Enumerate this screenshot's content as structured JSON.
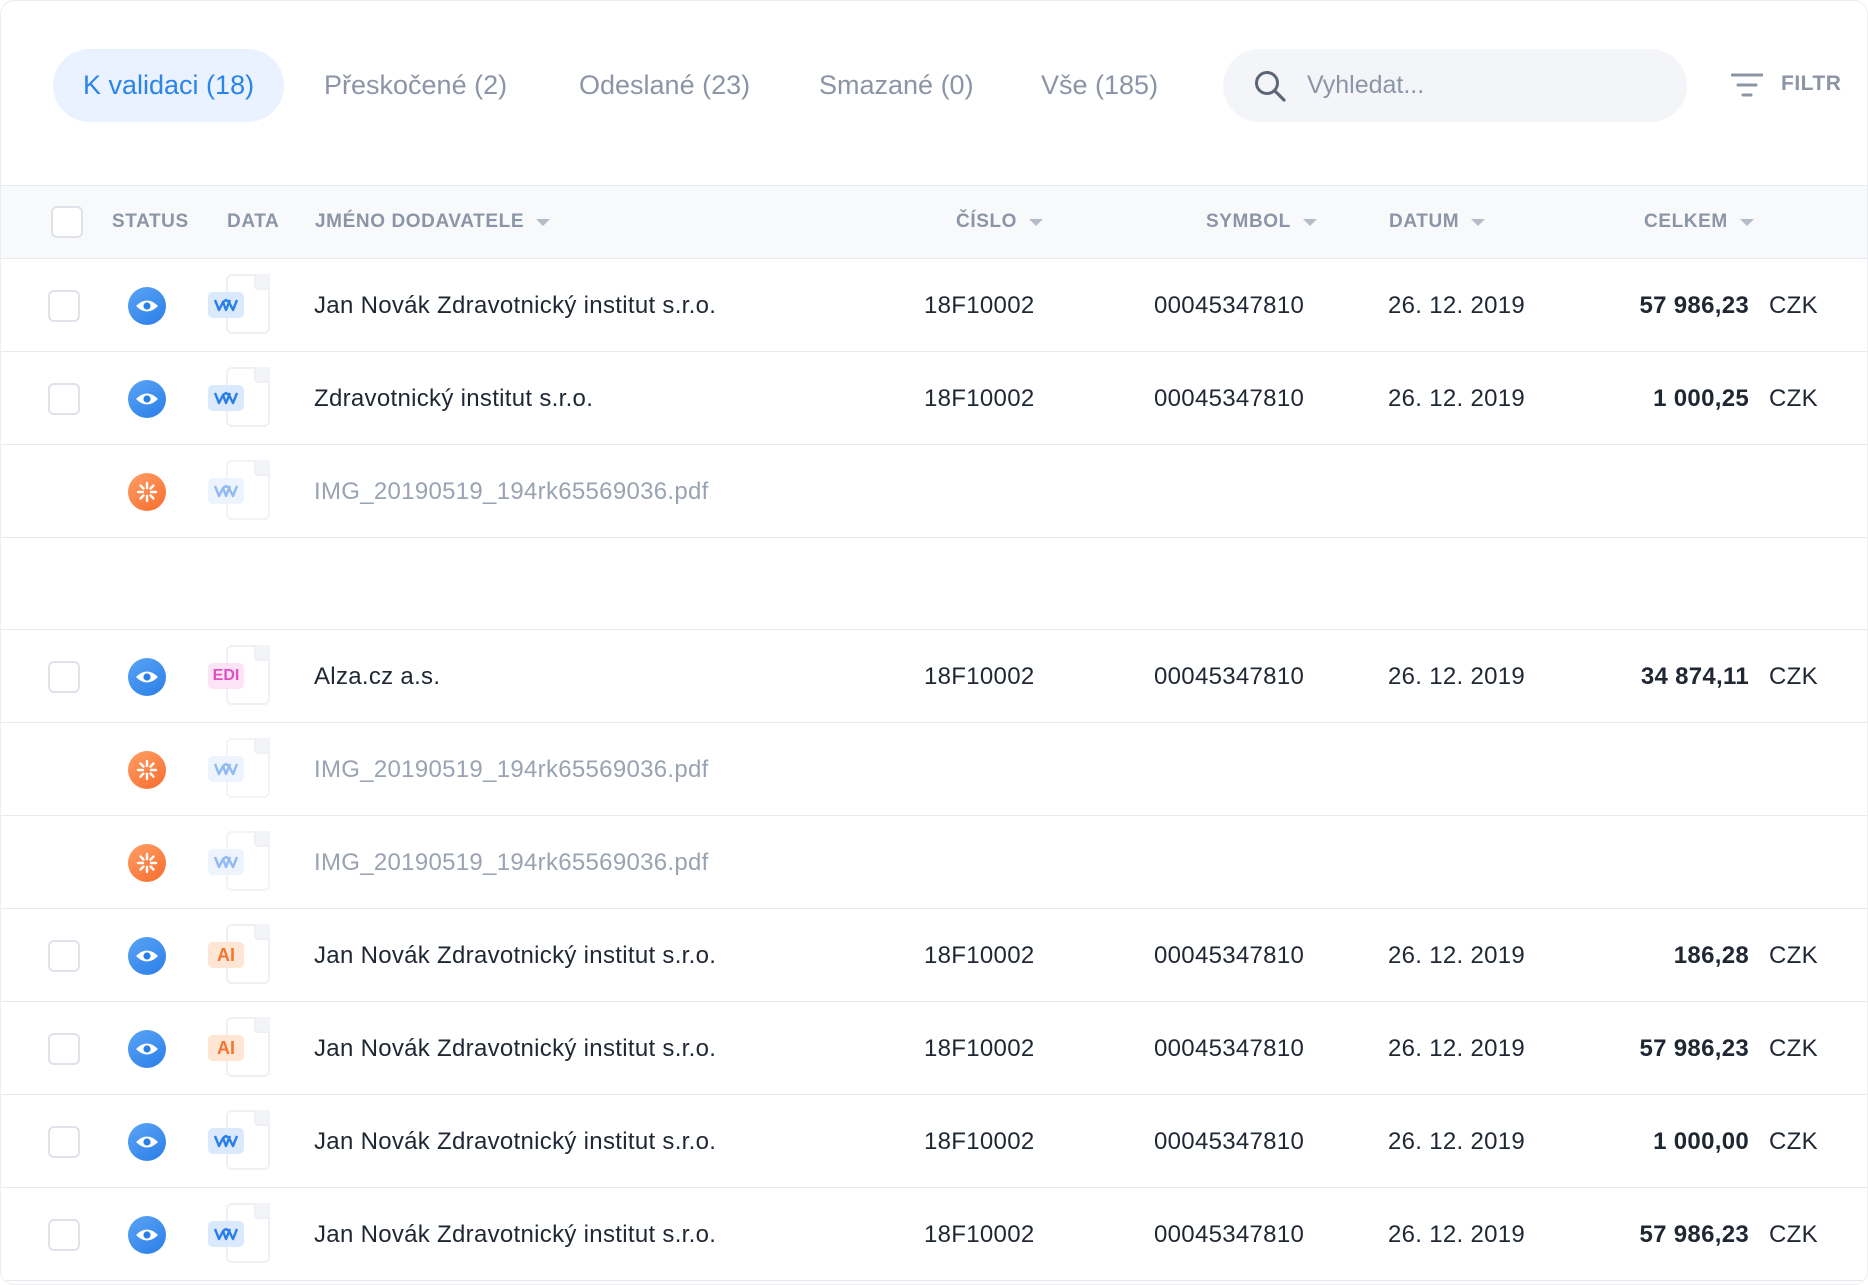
{
  "tabs": [
    {
      "label": "K validaci (18)",
      "active": true
    },
    {
      "label": "Přeskočené (2)",
      "active": false
    },
    {
      "label": "Odeslané (23)",
      "active": false
    },
    {
      "label": "Smazané (0)",
      "active": false
    },
    {
      "label": "Vše (185)",
      "active": false
    }
  ],
  "search": {
    "placeholder": "Vyhledat..."
  },
  "filter": {
    "label": "FILTR"
  },
  "columns": {
    "status": "STATUS",
    "data": "DATA",
    "name": "JMÉNO DODAVATELE",
    "cislo": "ČÍSLO",
    "symbol": "SYMBOL",
    "datum": "DATUM",
    "celkem": "CELKEM"
  },
  "rows": [
    {
      "status_icon": "eye-icon",
      "doc_badge": "w-logo",
      "name": "Jan Novák Zdravotnický institut s.r.o.",
      "cislo": "18F10002",
      "symbol": "00045347810",
      "datum": "26. 12. 2019",
      "amount": "57 986,23",
      "currency": "CZK"
    },
    {
      "status_icon": "eye-icon",
      "doc_badge": "w-logo",
      "name": "Zdravotnický institut s.r.o.",
      "cislo": "18F10002",
      "symbol": "00045347810",
      "datum": "26. 12. 2019",
      "amount": "1 000,25",
      "currency": "CZK"
    },
    {
      "status_icon": "processing-icon",
      "doc_badge": "w-logo",
      "name": "IMG_20190519_194rk65569036.pdf"
    },
    {
      "status_icon": "eye-icon",
      "doc_badge": "EDI",
      "name": "Alza.cz a.s.",
      "cislo": "18F10002",
      "symbol": "00045347810",
      "datum": "26. 12. 2019",
      "amount": "34 874,11",
      "currency": "CZK"
    },
    {
      "status_icon": "processing-icon",
      "doc_badge": "w-logo",
      "name": "IMG_20190519_194rk65569036.pdf"
    },
    {
      "status_icon": "processing-icon",
      "doc_badge": "w-logo",
      "name": "IMG_20190519_194rk65569036.pdf"
    },
    {
      "status_icon": "eye-icon",
      "doc_badge": "AI",
      "name": "Jan Novák Zdravotnický institut s.r.o.",
      "cislo": "18F10002",
      "symbol": "00045347810",
      "datum": "26. 12. 2019",
      "amount": "186,28",
      "currency": "CZK"
    },
    {
      "status_icon": "eye-icon",
      "doc_badge": "AI",
      "name": "Jan Novák Zdravotnický institut s.r.o.",
      "cislo": "18F10002",
      "symbol": "00045347810",
      "datum": "26. 12. 2019",
      "amount": "57 986,23",
      "currency": "CZK"
    },
    {
      "status_icon": "eye-icon",
      "doc_badge": "w-logo",
      "name": "Jan Novák Zdravotnický institut s.r.o.",
      "cislo": "18F10002",
      "symbol": "00045347810",
      "datum": "26. 12. 2019",
      "amount": "1 000,00",
      "currency": "CZK"
    },
    {
      "status_icon": "eye-icon",
      "doc_badge": "w-logo",
      "name": "Jan Novák Zdravotnický institut s.r.o.",
      "cislo": "18F10002",
      "symbol": "00045347810",
      "datum": "26. 12. 2019",
      "amount": "57 986,23",
      "currency": "CZK"
    }
  ],
  "colors": {
    "accent": "#2a84ec",
    "active_tab_bg": "#e9f2fe",
    "muted_text": "#8b95a6",
    "status_eye": "#3a8ff0",
    "status_processing": "#f7763a",
    "edi_badge": "#e14fc2",
    "ai_badge": "#f5752f"
  }
}
